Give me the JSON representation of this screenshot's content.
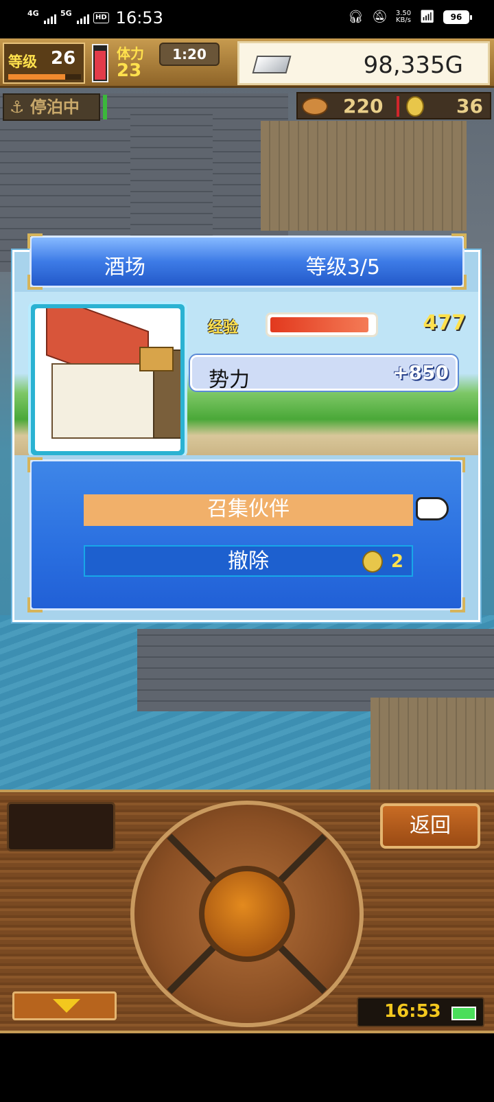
{
  "status_bar": {
    "network1": "4G",
    "network2": "5G",
    "hd": "HD",
    "time": "16:53",
    "speed_value": "3.50",
    "speed_unit": "KB/s",
    "battery": "96"
  },
  "hud": {
    "level_label": "等级",
    "level_value": "26",
    "stamina_label": "体力",
    "stamina_value": "23",
    "timer": "1:20",
    "gold": "98,335G",
    "mooring": "停泊中",
    "food": "220",
    "coins": "36"
  },
  "dialog": {
    "title": "酒场",
    "level": "等级3/5",
    "xp_label": "经验",
    "xp_value": "477",
    "xp_fill_percent": 95,
    "power_label": "势力",
    "power_value": "+850",
    "menu": {
      "recruit": "召集伙伴",
      "remove": "撤除",
      "remove_cost": "2"
    }
  },
  "controller": {
    "back": "返回",
    "clock": "16:53"
  }
}
